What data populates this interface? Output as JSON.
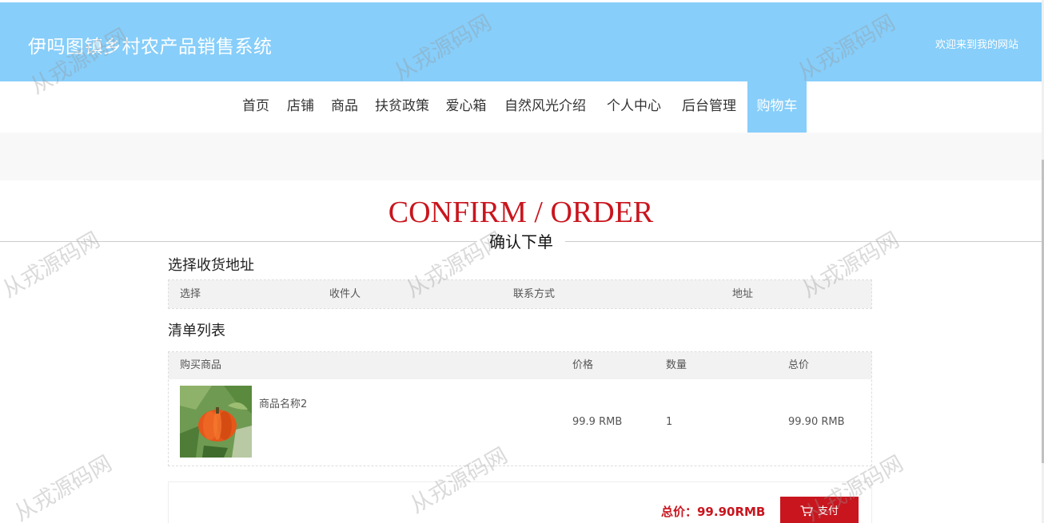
{
  "header": {
    "site_title": "伊吗图镇乡村农产品销售系统",
    "welcome": "欢迎来到我的网站"
  },
  "nav": {
    "items": [
      "首页",
      "店铺",
      "商品",
      "扶贫政策",
      "爱心箱",
      "自然风光介绍",
      "个人中心",
      "后台管理",
      "购物车"
    ],
    "active": "购物车"
  },
  "confirm": {
    "title": "CONFIRM / ORDER",
    "subtitle": "确认下单"
  },
  "address_section": {
    "title": "选择收货地址",
    "columns": [
      "选择",
      "收件人",
      "联系方式",
      "地址"
    ]
  },
  "order_section": {
    "title": "清单列表",
    "columns": [
      "购买商品",
      "价格",
      "数量",
      "总价"
    ],
    "rows": [
      {
        "name": "商品名称2",
        "price": "99.9 RMB",
        "qty": "1",
        "total": "99.90 RMB"
      }
    ]
  },
  "summary": {
    "total_label": "总价：99.90RMB",
    "pay_label": "支付"
  },
  "watermark": "从戎源码网",
  "colors": {
    "header_bg": "#87cefa",
    "accent_red": "#c9151e"
  }
}
